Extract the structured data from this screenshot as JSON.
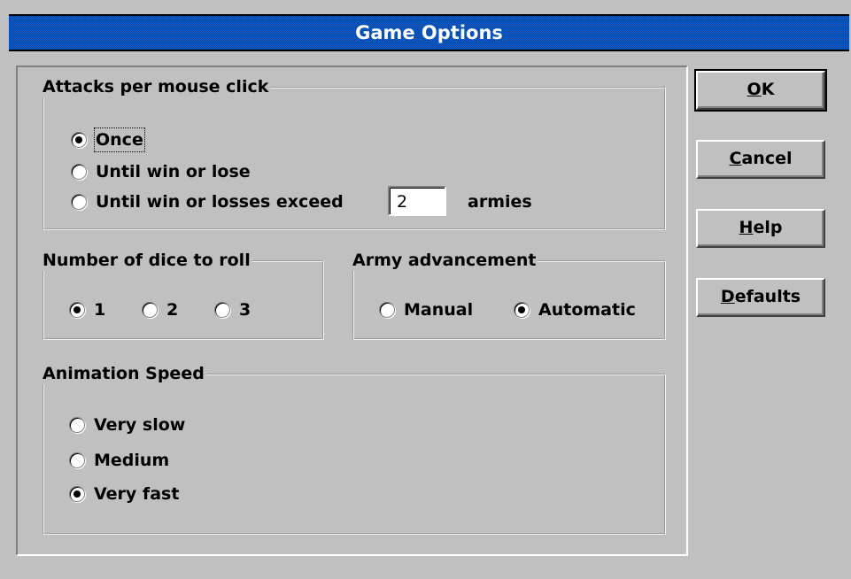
{
  "window": {
    "title": "Game Options"
  },
  "groups": {
    "attacks": {
      "title": "Attacks per mouse click",
      "options": [
        "Once",
        "Until win or lose",
        "Until win or losses exceed"
      ],
      "selected_index": 0,
      "armies_value": "2",
      "armies_label": "armies"
    },
    "dice": {
      "title": "Number of dice to roll",
      "options": [
        "1",
        "2",
        "3"
      ],
      "selected_index": 0
    },
    "advancement": {
      "title": "Army advancement",
      "options": [
        "Manual",
        "Automatic"
      ],
      "selected_index": 1
    },
    "animation": {
      "title": "Animation Speed",
      "options": [
        "Very slow",
        "Medium",
        "Very fast"
      ],
      "selected_index": 2
    }
  },
  "buttons": {
    "ok": {
      "mnemonic": "O",
      "rest": "K"
    },
    "cancel": {
      "mnemonic": "C",
      "rest": "ancel"
    },
    "help": {
      "mnemonic": "H",
      "rest": "elp"
    },
    "defaults": {
      "mnemonic": "D",
      "rest": "efaults"
    }
  }
}
